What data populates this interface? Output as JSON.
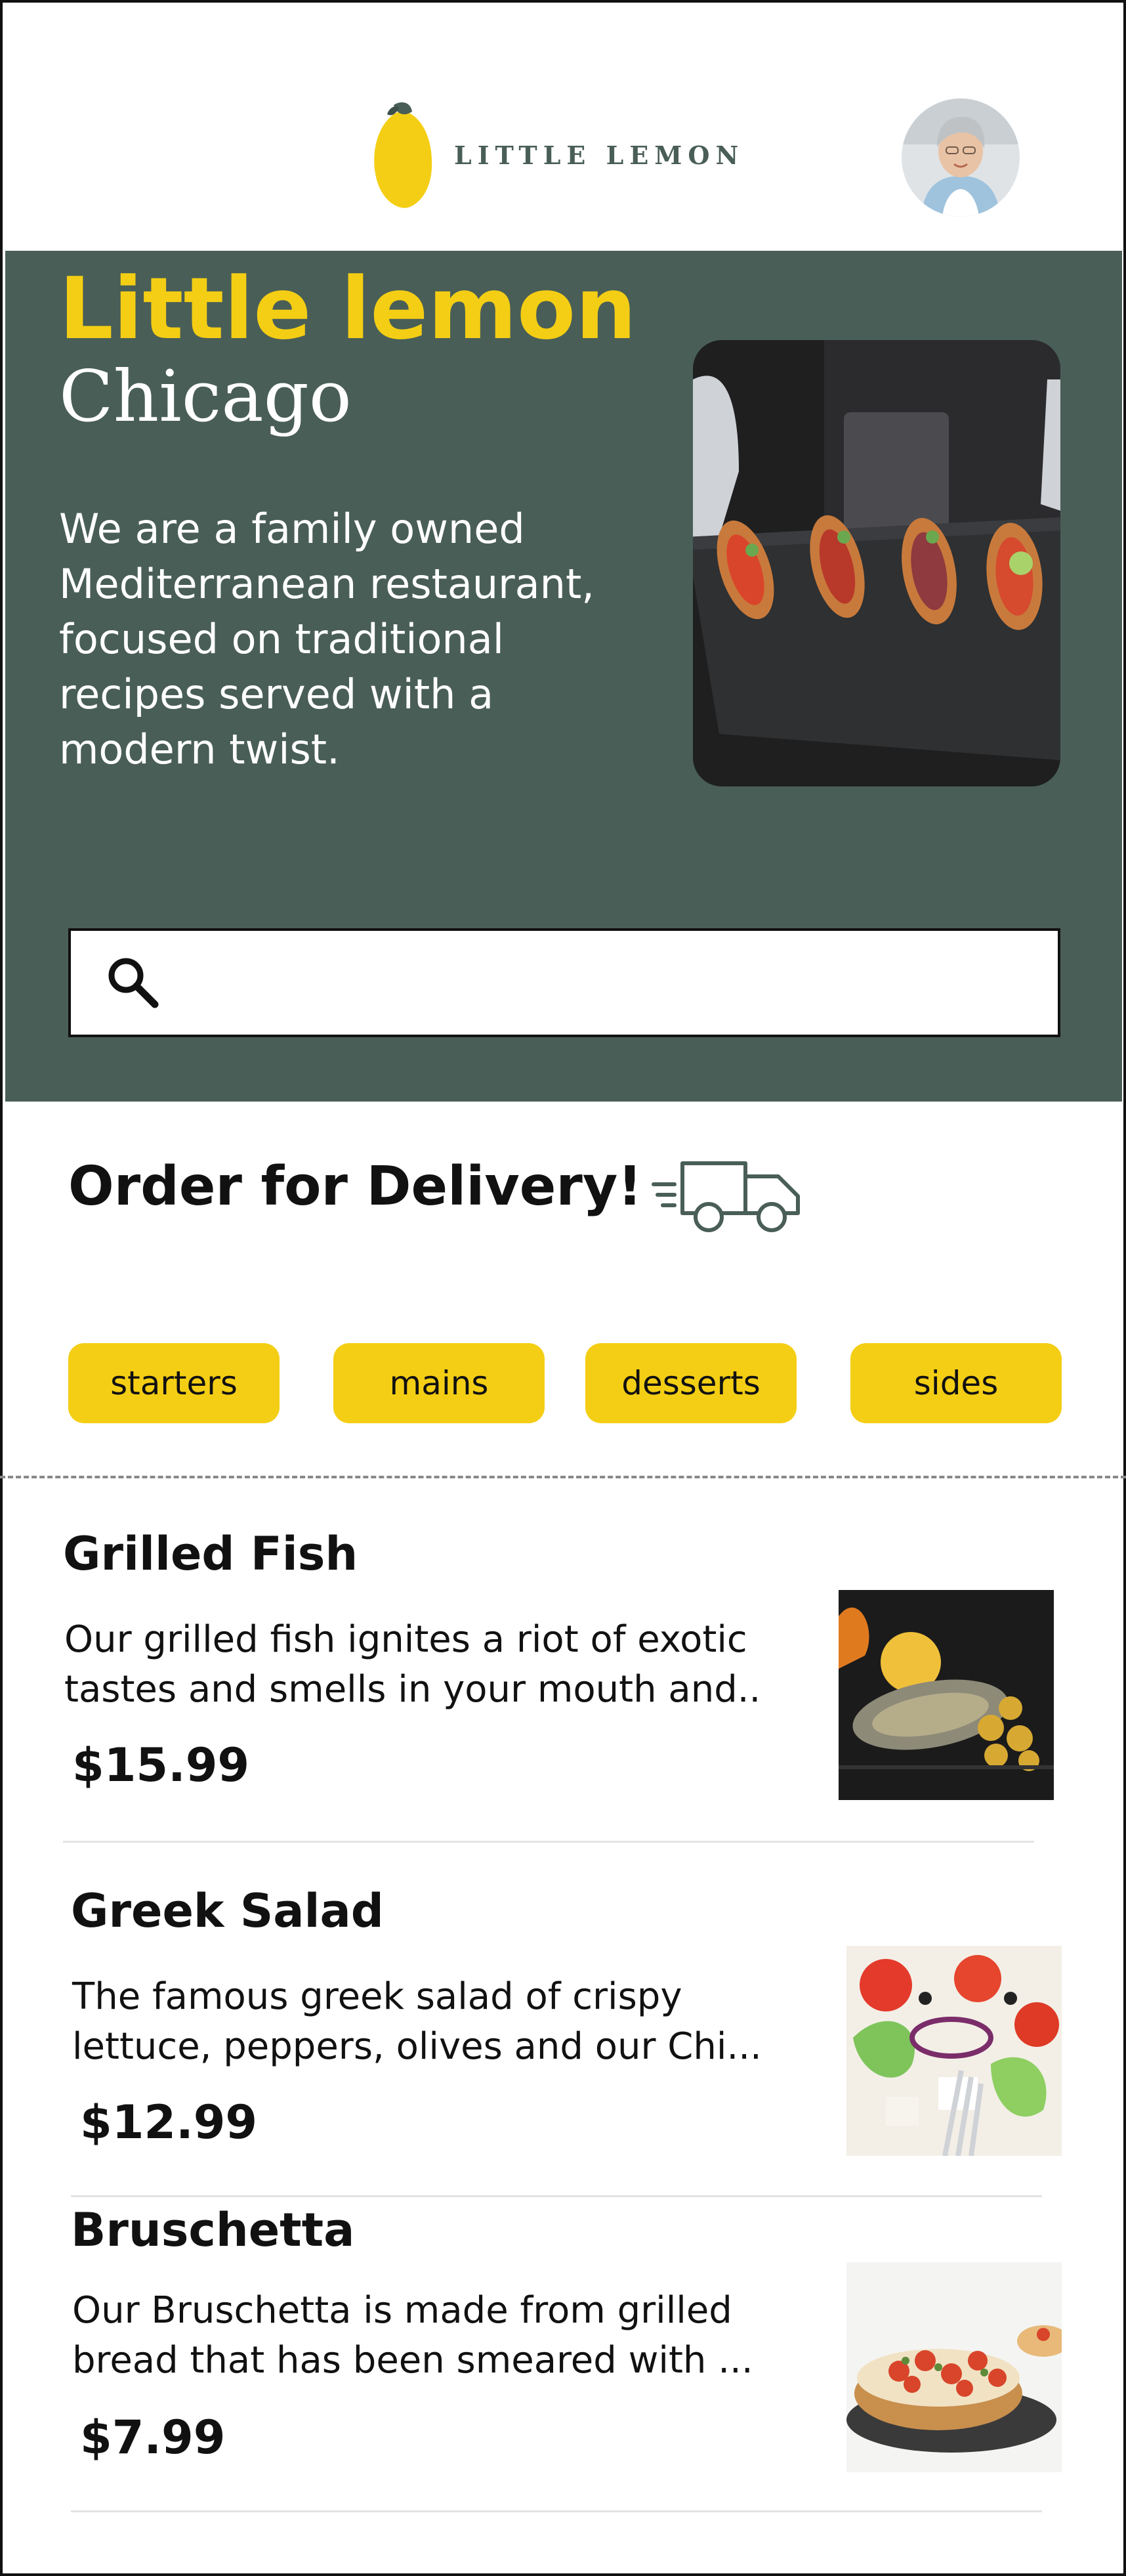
{
  "header": {
    "logo_text": "LITTLE LEMON",
    "avatar_alt": "user-avatar"
  },
  "hero": {
    "title": "Little lemon",
    "subtitle": "Chicago",
    "description": "We are a family owned Mediterranean restaurant, focused on traditional recipes served with a modern twist.",
    "search_placeholder": ""
  },
  "order": {
    "title": "Order for Delivery!"
  },
  "categories": [
    "starters",
    "mains",
    "desserts",
    "sides"
  ],
  "menu": [
    {
      "name": "Grilled Fish",
      "description": "Our grilled fish ignites a riot of exotic tastes and smells in your mouth and..",
      "price": "$15.99"
    },
    {
      "name": "Greek Salad",
      "description": "The famous greek salad of crispy lettuce, peppers, olives and our Chi...",
      "price": "$12.99"
    },
    {
      "name": "Bruschetta",
      "description": "Our Bruschetta is made from grilled bread that has been smeared with ...",
      "price": "$7.99"
    }
  ],
  "colors": {
    "primary_green": "#495E57",
    "primary_yellow": "#F4CE14",
    "text": "#111111",
    "background": "#FFFFFF"
  },
  "icons": {
    "logo": "lemon-icon",
    "search": "search-icon",
    "delivery": "delivery-truck-icon"
  }
}
